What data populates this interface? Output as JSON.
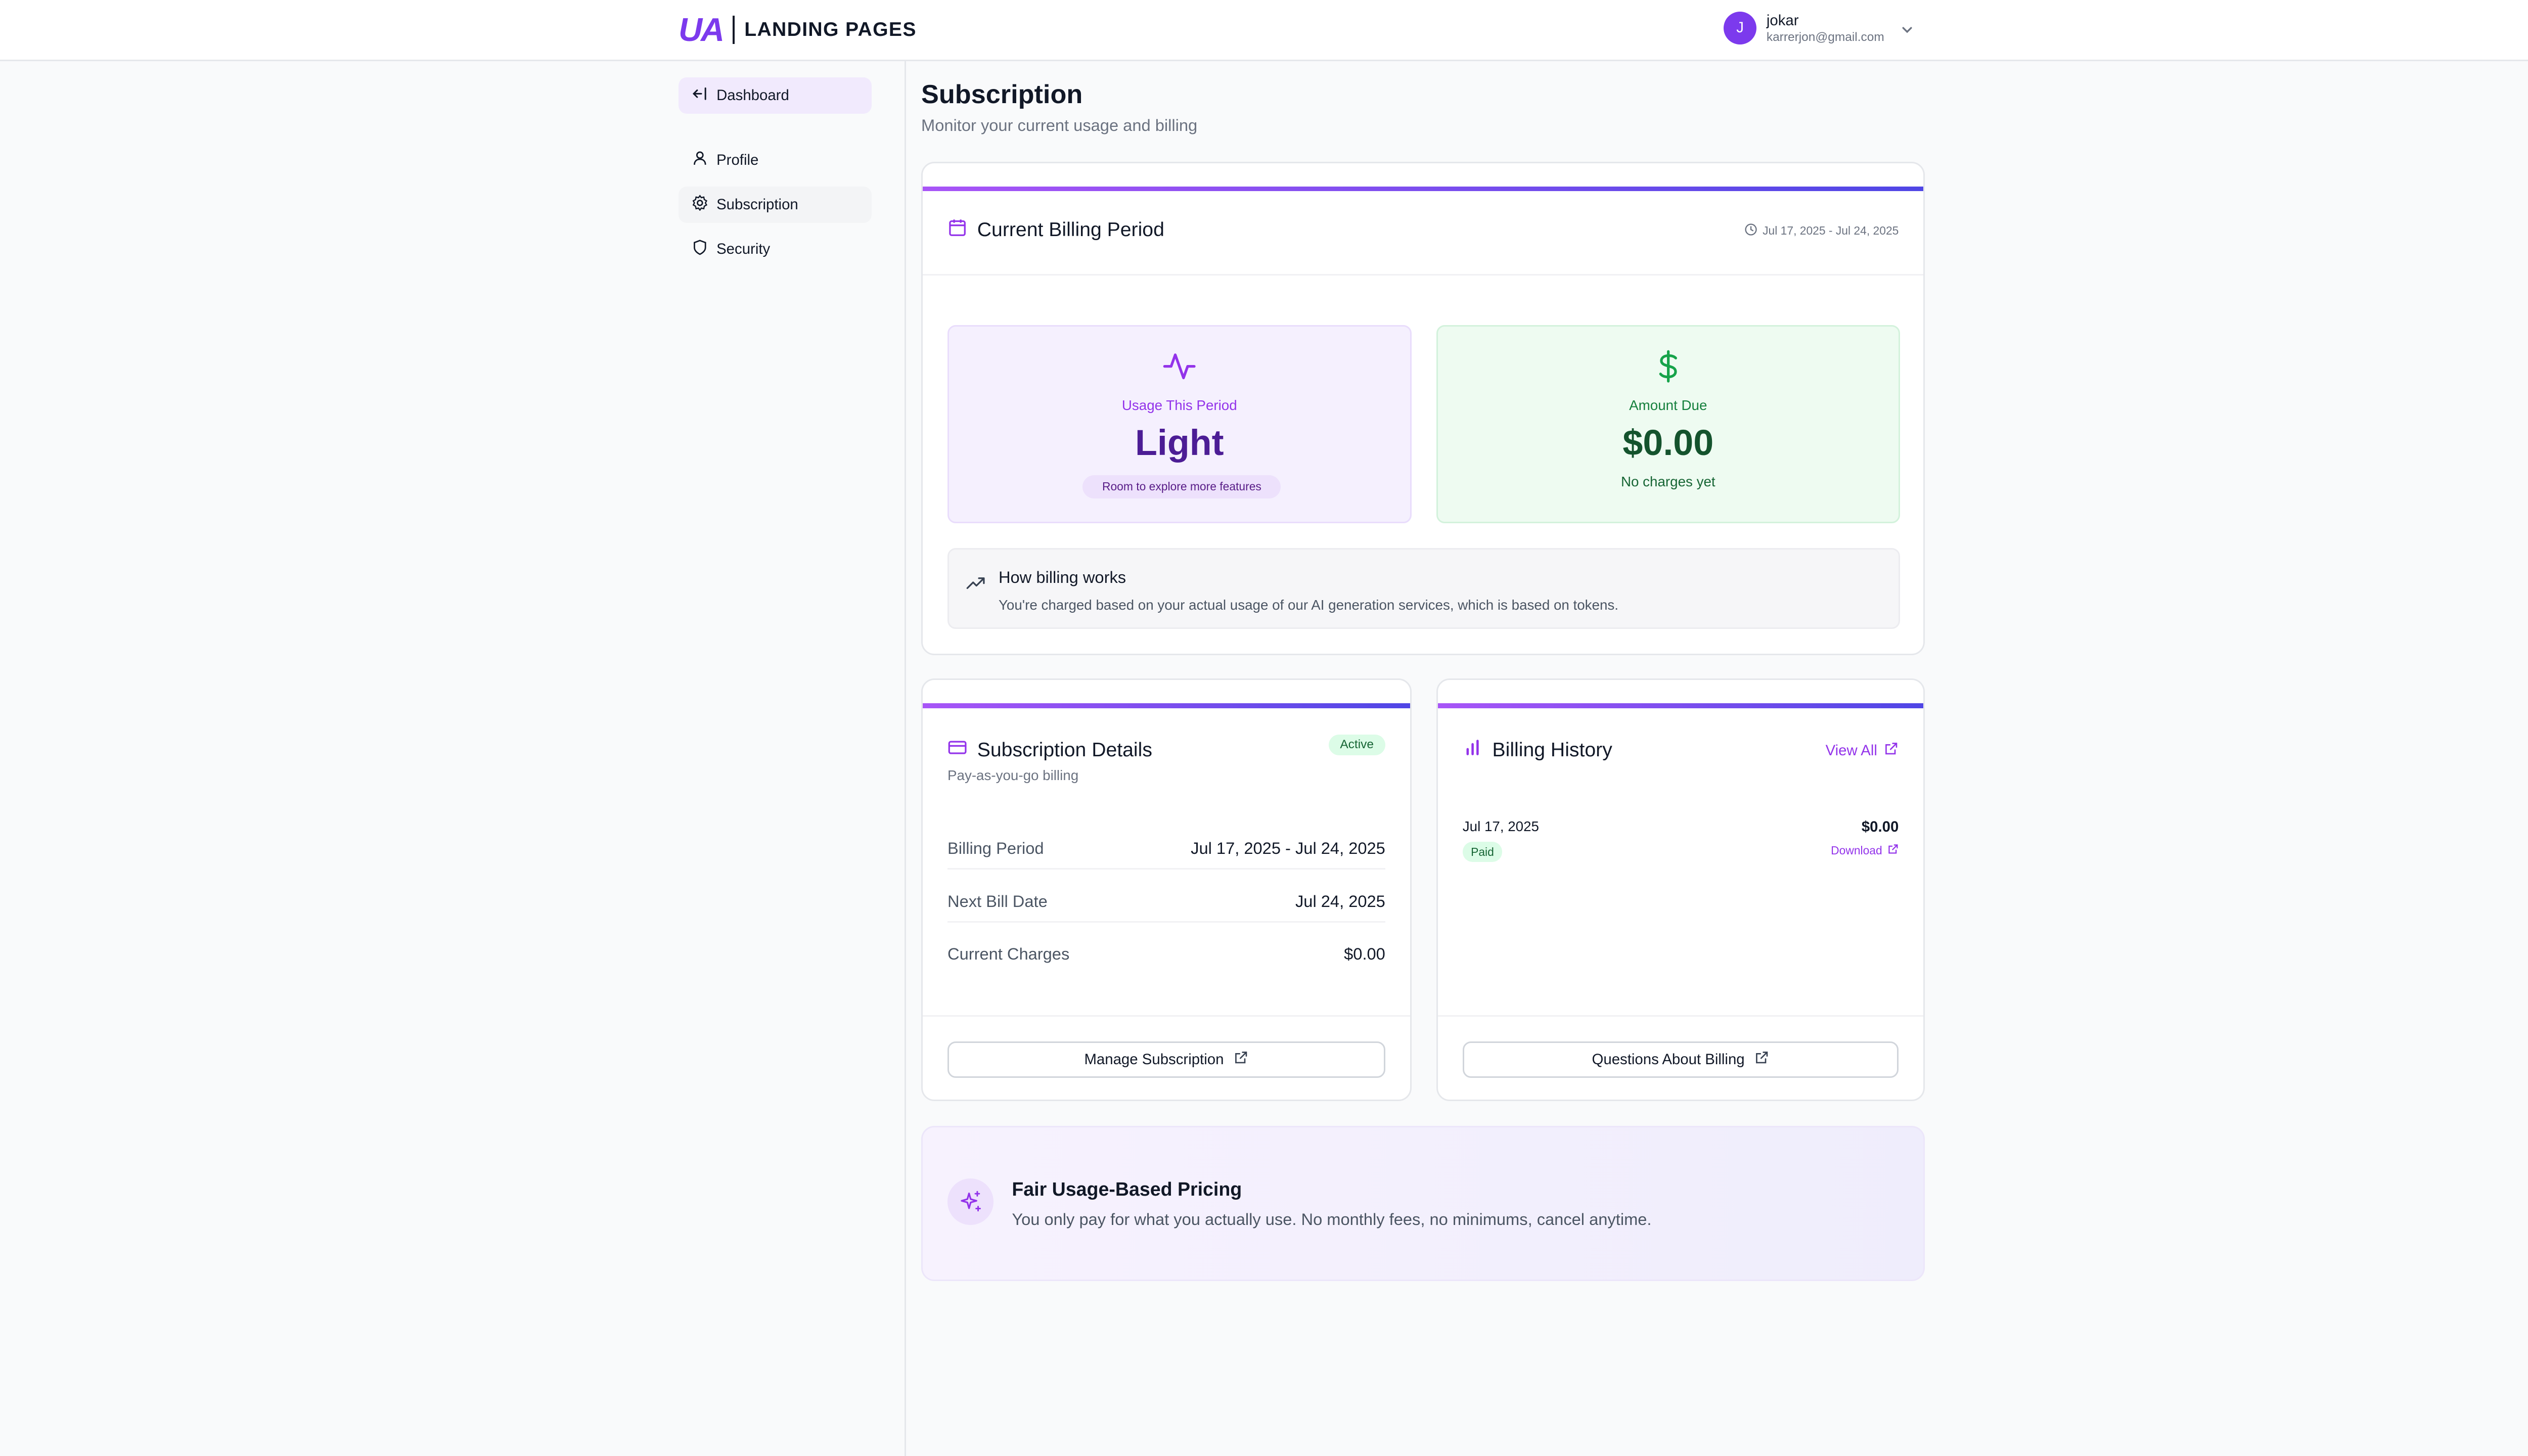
{
  "header": {
    "logo_mark": "UA",
    "logo_text": "LANDING PAGES",
    "user": {
      "initial": "J",
      "name": "jokar",
      "email": "karrerjon@gmail.com"
    }
  },
  "sidebar": {
    "dashboard_label": "Dashboard",
    "items": [
      {
        "label": "Profile",
        "icon": "user-icon"
      },
      {
        "label": "Subscription",
        "icon": "gear-icon",
        "active": true
      },
      {
        "label": "Security",
        "icon": "shield-icon"
      }
    ]
  },
  "page": {
    "title": "Subscription",
    "subtitle": "Monitor your current usage and billing"
  },
  "billing_period": {
    "title": "Current Billing Period",
    "range": "Jul 17, 2025 - Jul 24, 2025",
    "usage": {
      "label": "Usage This Period",
      "value": "Light",
      "pill": "Room to explore more features"
    },
    "amount": {
      "label": "Amount Due",
      "value": "$0.00",
      "note": "No charges yet"
    },
    "how": {
      "title": "How billing works",
      "text": "You're charged based on your actual usage of our AI generation services, which is based on tokens."
    }
  },
  "subscription_details": {
    "title": "Subscription Details",
    "status": "Active",
    "caption": "Pay-as-you-go billing",
    "rows": [
      {
        "label": "Billing Period",
        "value": "Jul 17, 2025 - Jul 24, 2025"
      },
      {
        "label": "Next Bill Date",
        "value": "Jul 24, 2025"
      },
      {
        "label": "Current Charges",
        "value": "$0.00"
      }
    ],
    "button_label": "Manage Subscription"
  },
  "billing_history": {
    "title": "Billing History",
    "view_all_label": "View All",
    "entries": [
      {
        "date": "Jul 17, 2025",
        "status": "Paid",
        "amount": "$0.00",
        "download_label": "Download"
      }
    ],
    "button_label": "Questions About Billing"
  },
  "promo": {
    "title": "Fair Usage-Based Pricing",
    "text": "You only pay for what you actually use. No monthly fees, no minimums, cancel anytime."
  },
  "colors": {
    "accent": "#7c3aed",
    "accent_text": "#9333ea",
    "success": "#16a34a",
    "bar_start": "#a855f7",
    "bar_end": "#4f46e5"
  }
}
